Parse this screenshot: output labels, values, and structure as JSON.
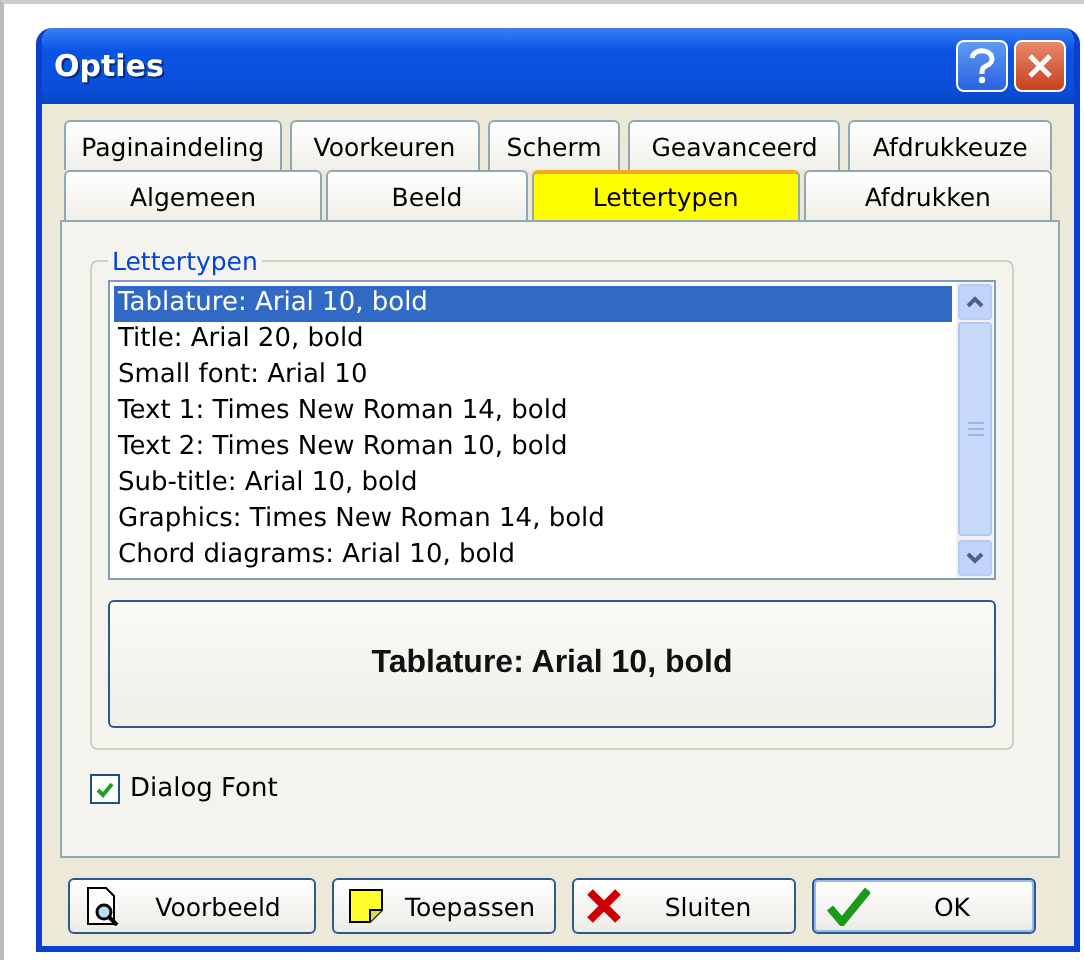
{
  "window": {
    "title": "Opties"
  },
  "tab_rows": [
    [
      {
        "label": "Paginaindeling",
        "selected": false
      },
      {
        "label": "Voorkeuren",
        "selected": false
      },
      {
        "label": "Scherm",
        "selected": false
      },
      {
        "label": "Geavanceerd",
        "selected": false
      },
      {
        "label": "Afdrukkeuze",
        "selected": false
      }
    ],
    [
      {
        "label": "Algemeen",
        "selected": false
      },
      {
        "label": "Beeld",
        "selected": false
      },
      {
        "label": "Lettertypen",
        "selected": true
      },
      {
        "label": "Afdrukken",
        "selected": false
      }
    ]
  ],
  "group": {
    "title": "Lettertypen",
    "fonts": [
      {
        "label": "Tablature: Arial 10, bold",
        "selected": true
      },
      {
        "label": "Title: Arial 20, bold",
        "selected": false
      },
      {
        "label": "Small font: Arial 10",
        "selected": false
      },
      {
        "label": "Text 1: Times New Roman 14, bold",
        "selected": false
      },
      {
        "label": "Text 2: Times New Roman 10, bold",
        "selected": false
      },
      {
        "label": "Sub-title: Arial 10, bold",
        "selected": false
      },
      {
        "label": "Graphics: Times New Roman 14, bold",
        "selected": false
      },
      {
        "label": "Chord diagrams: Arial 10, bold",
        "selected": false
      }
    ],
    "preview": "Tablature: Arial 10, bold"
  },
  "dialog_font": {
    "label": "Dialog Font",
    "checked": true
  },
  "buttons": [
    {
      "kind": "preview",
      "label": "Voorbeeld"
    },
    {
      "kind": "apply",
      "label": "Toepassen"
    },
    {
      "kind": "close",
      "label": "Sluiten"
    },
    {
      "kind": "ok",
      "label": "OK"
    }
  ]
}
